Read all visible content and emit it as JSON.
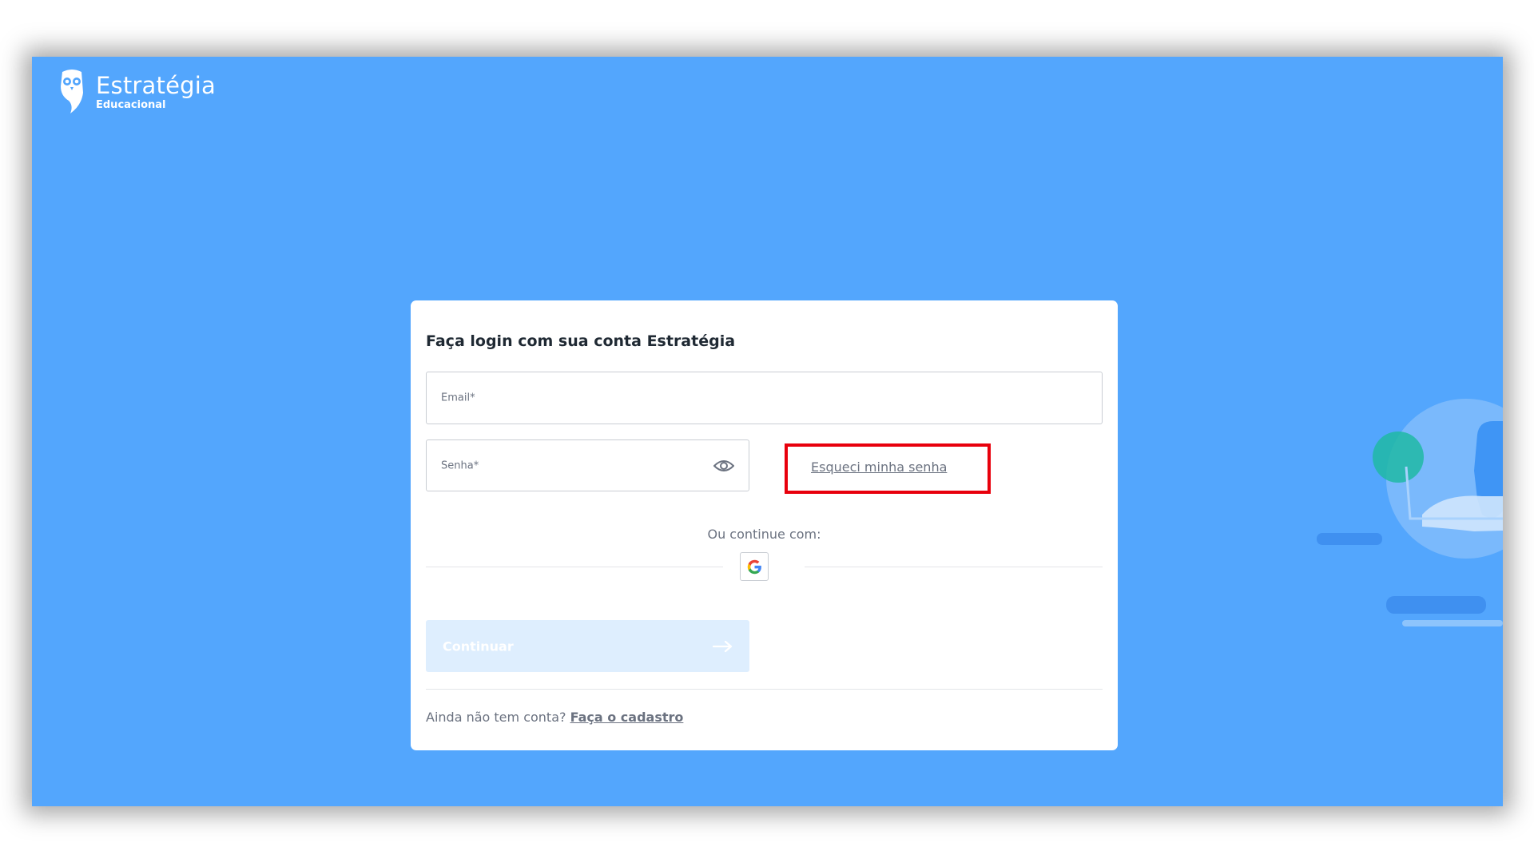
{
  "brand": {
    "name": "Estratégia",
    "tagline": "Educacional"
  },
  "login": {
    "title": "Faça login com sua conta Estratégia",
    "email_label": "Email*",
    "password_label": "Senha*",
    "forgot_password": "Esqueci minha senha",
    "or_continue": "Ou continue com:",
    "continue_button": "Continuar",
    "no_account": "Ainda não tem conta?",
    "signup_link": "Faça o cadastro"
  },
  "colors": {
    "background": "#53a6fd",
    "highlight_border": "#e8000c",
    "continue_disabled": "#deeefe"
  },
  "icons": {
    "logo": "owl-logo-icon",
    "eye": "eye-icon",
    "google": "google-icon",
    "arrow": "arrow-right-icon"
  }
}
